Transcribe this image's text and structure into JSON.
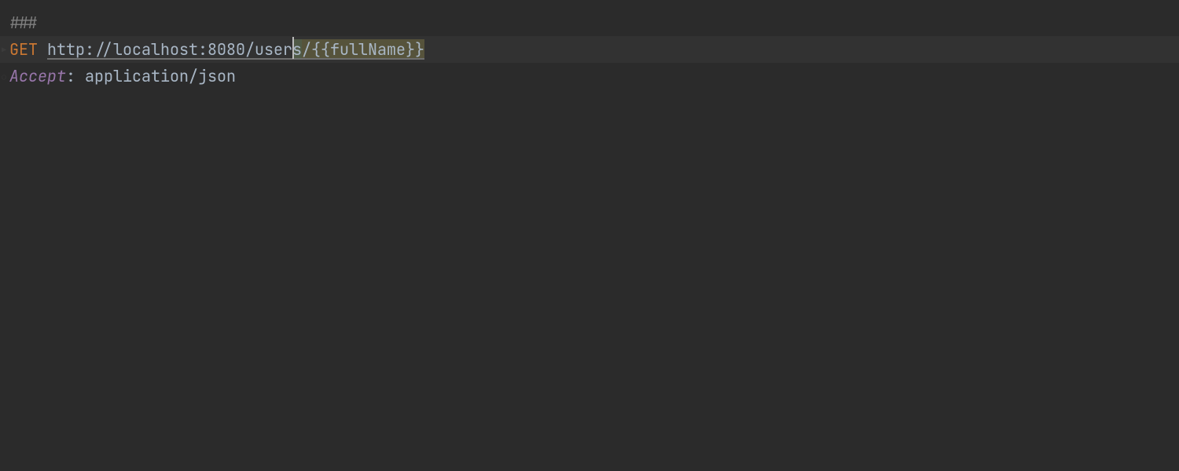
{
  "editor": {
    "separator": "###",
    "method": "GET",
    "url_part1": "http://localhost:8080/user",
    "url_part2_s": "s",
    "url_part3_slash": "/",
    "url_template": "{{fullName}}",
    "header_name": "Accept",
    "header_colon": ":",
    "header_value": " application/json"
  }
}
